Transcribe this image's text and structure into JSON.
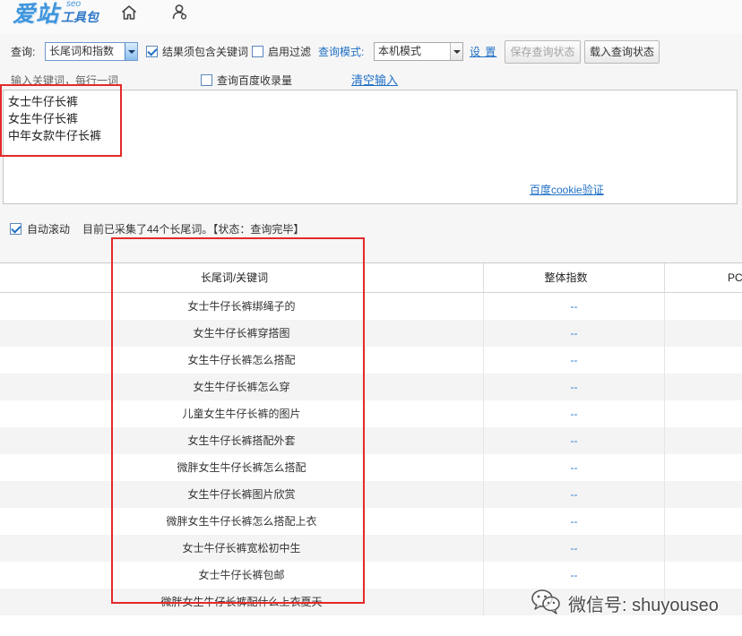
{
  "header": {
    "logo_main": "爱站",
    "logo_sup": "seo",
    "logo_sub": "工具包",
    "nav_icons": [
      "home-icon",
      "user-icon"
    ]
  },
  "toolbar": {
    "query_label": "查询:",
    "query_type": "长尾词和指数",
    "must_contain_label": "结果须包含关键词",
    "must_contain_checked": true,
    "filter_label": "启用过滤",
    "filter_checked": false,
    "mode_label": "查询模式:",
    "mode_value": "本机模式",
    "settings_link": "设 置",
    "save_state_button": "保存查询状态",
    "load_state_button": "载入查询状态"
  },
  "input_section": {
    "hint": "输入关键词，每行一词",
    "baidu_index_label": "查询百度收录量",
    "baidu_index_checked": false,
    "clear_link": "清空输入",
    "keywords": [
      "女士牛仔长裤",
      "女生牛仔长裤",
      "中年女款牛仔长裤"
    ],
    "cookie_link": "百度cookie验证"
  },
  "status": {
    "auto_scroll_label": "自动滚动",
    "auto_scroll_checked": true,
    "message": "目前已采集了44个长尾词。【状态：查询完毕】"
  },
  "table": {
    "columns": {
      "keyword": "长尾词/关键词",
      "index": "整体指数",
      "pc": "PC"
    },
    "rows": [
      {
        "keyword": "女士牛仔长裤绑绳子的",
        "index": "--"
      },
      {
        "keyword": "女生牛仔长裤穿搭图",
        "index": "--"
      },
      {
        "keyword": "女生牛仔长裤怎么搭配",
        "index": "--"
      },
      {
        "keyword": "女生牛仔长裤怎么穿",
        "index": "--"
      },
      {
        "keyword": "儿童女生牛仔长裤的图片",
        "index": "--"
      },
      {
        "keyword": "女生牛仔长裤搭配外套",
        "index": "--"
      },
      {
        "keyword": "微胖女生牛仔长裤怎么搭配",
        "index": "--"
      },
      {
        "keyword": "女生牛仔长裤图片欣赏",
        "index": "--"
      },
      {
        "keyword": "微胖女生牛仔长裤怎么搭配上衣",
        "index": "--"
      },
      {
        "keyword": "女士牛仔长裤宽松初中生",
        "index": "--"
      },
      {
        "keyword": "女士牛仔长裤包邮",
        "index": "--"
      },
      {
        "keyword": "微胖女生牛仔长裤配什么上衣夏天",
        "index": "--"
      }
    ]
  },
  "watermark": {
    "icon": "wechat-icon",
    "text": "微信号: shuyouseo"
  },
  "colors": {
    "accent": "#1f6fc5",
    "annotation": "#e42a2a",
    "alt_row": "#f4f4f4",
    "index_value": "#2b7bd0"
  }
}
